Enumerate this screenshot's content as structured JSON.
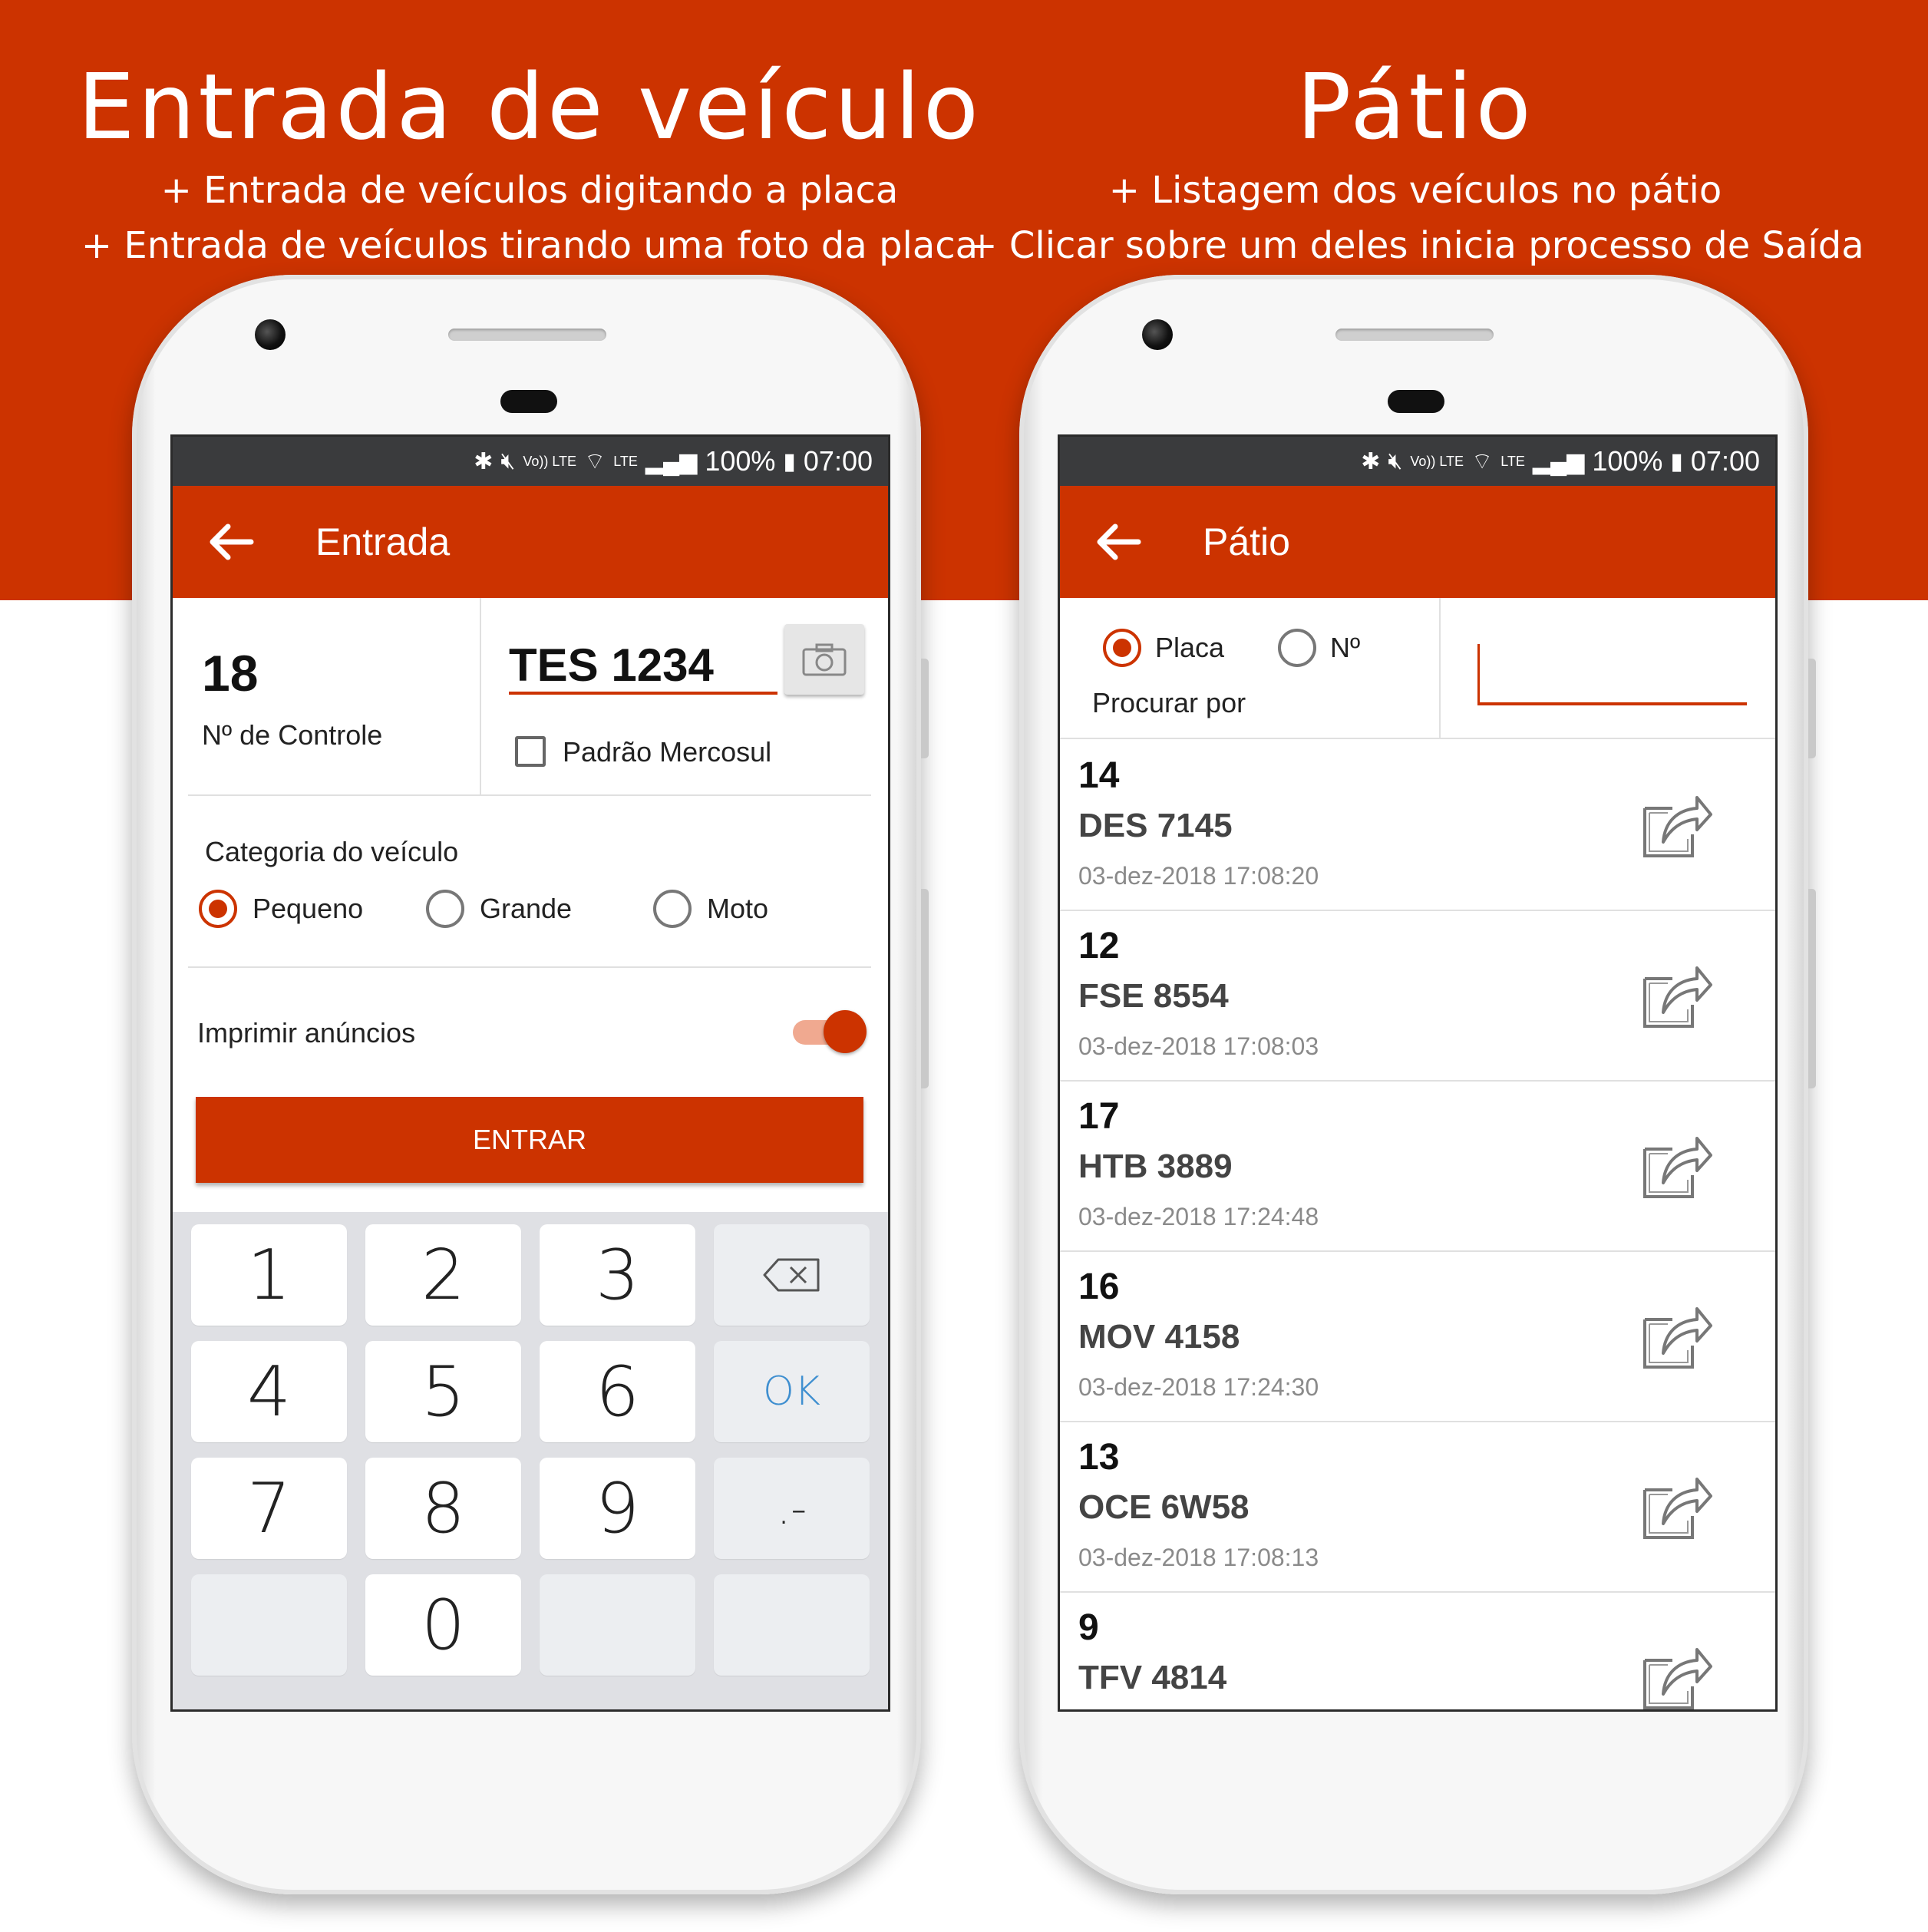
{
  "banner": {
    "left": {
      "title": "Entrada de veículo",
      "lines": [
        "+ Entrada de veículos digitando a placa",
        "+ Entrada de veículos tirando uma foto da placa"
      ]
    },
    "right": {
      "title": "Pátio",
      "lines": [
        "+ Listagem dos veículos no pátio",
        "+ Clicar sobre um deles inicia processo de Saída"
      ]
    }
  },
  "status": {
    "battery": "100%",
    "time": "07:00",
    "lte": "LTE",
    "volte": "Vo)) LTE"
  },
  "colors": {
    "brand": "#cc3300",
    "statusbar": "#3a3b3d",
    "keypad_ok": "#3f8fd0"
  },
  "entrada": {
    "appbar_title": "Entrada",
    "control_number": "18",
    "control_label": "Nº de Controle",
    "plate_value": "TES 1234",
    "mercosul_label": "Padrão Mercosul",
    "mercosul_checked": false,
    "category_title": "Categoria do veículo",
    "categories": [
      {
        "label": "Pequeno",
        "selected": true
      },
      {
        "label": "Grande",
        "selected": false
      },
      {
        "label": "Moto",
        "selected": false
      }
    ],
    "print_label": "Imprimir anúncios",
    "print_enabled": true,
    "enter_button": "ENTRAR",
    "keypad": {
      "k1": "1",
      "k2": "2",
      "k3": "3",
      "k4": "4",
      "k5": "5",
      "k6": "6",
      "k7": "7",
      "k8": "8",
      "k9": "9",
      "k0": "0",
      "ok": "OK",
      "dot": ".-"
    }
  },
  "patio": {
    "appbar_title": "Pátio",
    "search_options": [
      {
        "label": "Placa",
        "selected": true
      },
      {
        "label": "Nº",
        "selected": false
      }
    ],
    "search_label": "Procurar por",
    "search_value": "",
    "items": [
      {
        "number": "14",
        "plate": "DES 7145",
        "date": "03-dez-2018 17:08:20"
      },
      {
        "number": "12",
        "plate": "FSE 8554",
        "date": "03-dez-2018 17:08:03"
      },
      {
        "number": "17",
        "plate": "HTB 3889",
        "date": "03-dez-2018 17:24:48"
      },
      {
        "number": "16",
        "plate": "MOV 4158",
        "date": "03-dez-2018 17:24:30"
      },
      {
        "number": "13",
        "plate": "OCE 6W58",
        "date": "03-dez-2018 17:08:13"
      },
      {
        "number": "9",
        "plate": "TFV 4814",
        "date": ""
      }
    ]
  }
}
